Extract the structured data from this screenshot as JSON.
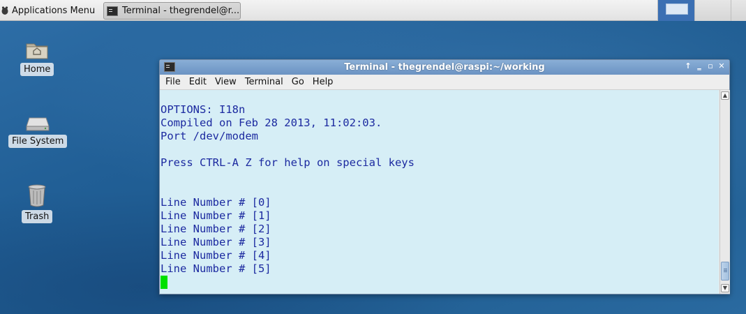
{
  "panel": {
    "app_menu_label": "Applications Menu",
    "taskbar_item": "Terminal - thegrendel@r...",
    "workspaces": 4
  },
  "desktop": {
    "icons": [
      {
        "label": "Home",
        "icon": "home-folder-icon"
      },
      {
        "label": "File System",
        "icon": "drive-icon"
      },
      {
        "label": "Trash",
        "icon": "trash-icon"
      }
    ]
  },
  "window": {
    "title": "Terminal - thegrendel@raspi:~/working",
    "controls": [
      "↑",
      "‗",
      "▫",
      "✕"
    ],
    "menu": [
      "File",
      "Edit",
      "View",
      "Terminal",
      "Go",
      "Help"
    ]
  },
  "terminal": {
    "lines": [
      "",
      "OPTIONS: I18n",
      "Compiled on Feb 28 2013, 11:02:03.",
      "Port /dev/modem",
      "",
      "Press CTRL-A Z for help on special keys",
      "",
      "",
      "Line Number # [0]",
      "Line Number # [1]",
      "Line Number # [2]",
      "Line Number # [3]",
      "Line Number # [4]",
      "Line Number # [5]"
    ],
    "text_color": "#1c2aa0",
    "background_color": "#d6eef6",
    "cursor_color": "#00e000"
  }
}
